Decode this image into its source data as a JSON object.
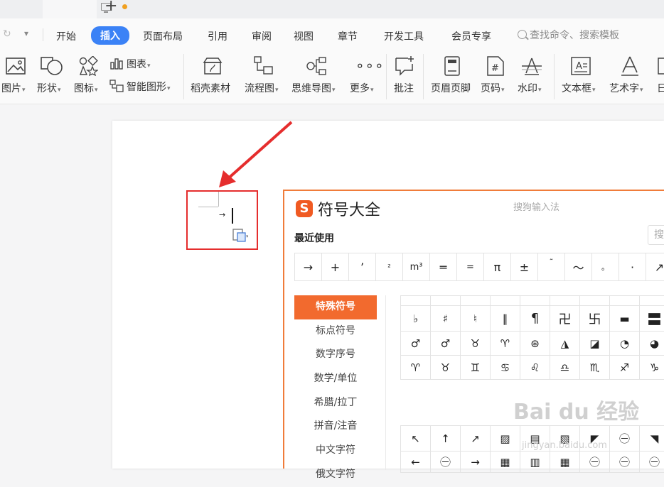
{
  "menu": {
    "items": [
      "开始",
      "插入",
      "页面布局",
      "引用",
      "审阅",
      "视图",
      "章节",
      "开发工具",
      "会员专享"
    ],
    "active": "插入",
    "search_placeholder": "查找命令、搜索模板"
  },
  "ribbon": {
    "picture": "图片",
    "shape": "形状",
    "icon": "图标",
    "chart": "图表",
    "smart_art": "智能图形",
    "docer_material": "稻壳素材",
    "flowchart": "流程图",
    "mindmap": "思维导图",
    "more": "更多",
    "comment": "批注",
    "header_footer": "页眉页脚",
    "page_number": "页码",
    "watermark": "水印",
    "textbox": "文本框",
    "wordart": "艺术字",
    "date_partial": "日"
  },
  "dialog": {
    "logo_letter": "S",
    "title": "符号大全",
    "brand": "搜狗输入法",
    "recent_label": "最近使用",
    "search_placeholder": "搜",
    "recent_symbols": [
      "→",
      "+",
      "’",
      "²",
      "m³",
      "═",
      "=",
      "π",
      "±",
      "˜",
      "〜",
      "。",
      "·",
      "↗"
    ],
    "categories": [
      "特殊符号",
      "标点符号",
      "数字序号",
      "数学/单位",
      "希腊/拉丁",
      "拼音/注音",
      "中文字符",
      "俄文字符"
    ],
    "selected_category": "特殊符号",
    "grid_top": [
      "",
      "",
      "",
      "",
      "",
      "",
      "",
      "",
      ""
    ],
    "grid_row1": [
      "♭",
      "♯",
      "♮",
      "‖",
      "¶",
      "卍",
      "卐",
      "▬",
      "〓"
    ],
    "grid_row2": [
      "♂",
      "♂",
      "♉",
      "♈",
      "⊛",
      "◮",
      "◪",
      "◔",
      "◕"
    ],
    "grid_row3": [
      "♈",
      "♉",
      "♊",
      "♋",
      "♌",
      "♎",
      "♏",
      "♐",
      "♑"
    ],
    "grid_row4": [
      "↖",
      "↑",
      "↗",
      "▨",
      "▤",
      "▧",
      "◤",
      "㊀",
      "◥"
    ],
    "grid_row5": [
      "←",
      "㊀",
      "→",
      "▦",
      "▥",
      "▦",
      "㊀",
      "㊀",
      "㊀"
    ]
  },
  "watermark": {
    "text": "Bai du 经验",
    "sub": "jingyan.baidu.com"
  },
  "colors": {
    "accent_blue": "#3b82f6",
    "dialog_orange": "#f26a2e",
    "highlight_red": "#e52d2d"
  }
}
